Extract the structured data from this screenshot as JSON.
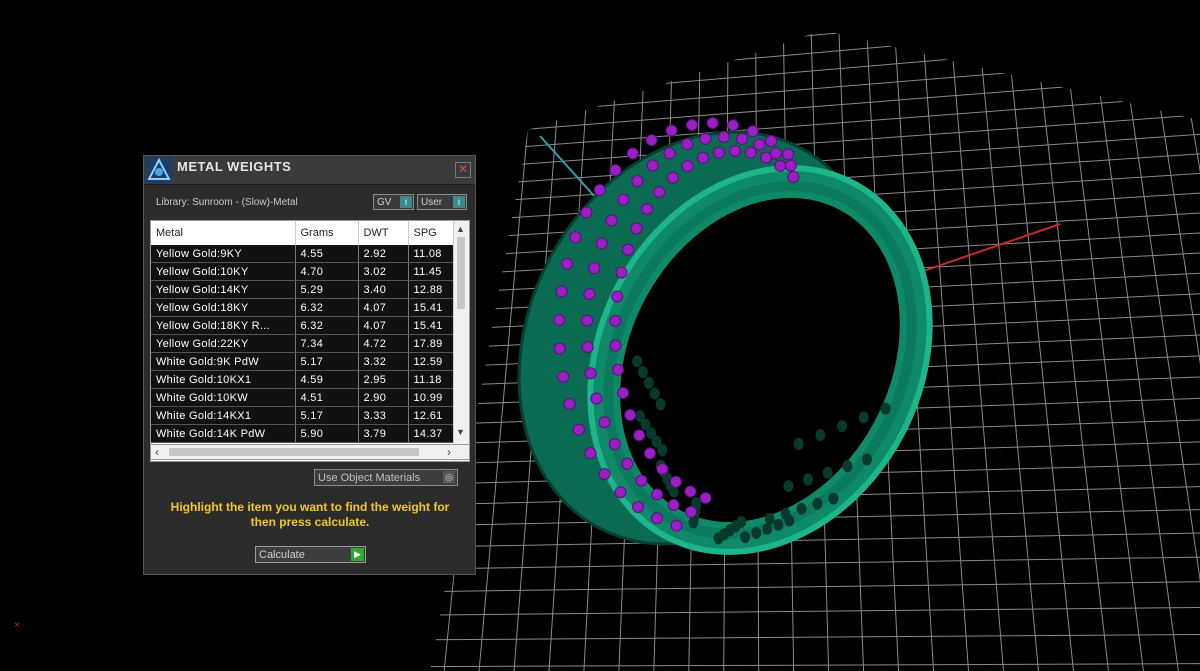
{
  "panel": {
    "title": "METAL WEIGHTS",
    "close_glyph": "✕",
    "library_label": "Library: Sunroom - (Slow)-Metal",
    "toggles": [
      {
        "label": "GV",
        "icon": "info-icon"
      },
      {
        "label": "User",
        "icon": "info-icon"
      }
    ],
    "columns": [
      "Metal",
      "Grams",
      "DWT",
      "SPG"
    ],
    "rows": [
      [
        "Yellow Gold:9KY",
        "4.55",
        "2.92",
        "11.08"
      ],
      [
        "Yellow Gold:10KY",
        "4.70",
        "3.02",
        "11.45"
      ],
      [
        "Yellow Gold:14KY",
        "5.29",
        "3.40",
        "12.88"
      ],
      [
        "Yellow Gold:18KY",
        "6.32",
        "4.07",
        "15.41"
      ],
      [
        "Yellow Gold:18KY R...",
        "6.32",
        "4.07",
        "15.41"
      ],
      [
        "Yellow Gold:22KY",
        "7.34",
        "4.72",
        "17.89"
      ],
      [
        "White Gold:9K PdW",
        "5.17",
        "3.32",
        "12.59"
      ],
      [
        "White Gold:10KX1",
        "4.59",
        "2.95",
        "11.18"
      ],
      [
        "White Gold:10KW",
        "4.51",
        "2.90",
        "10.99"
      ],
      [
        "White Gold:14KX1",
        "5.17",
        "3.33",
        "12.61"
      ],
      [
        "White Gold:14K PdW",
        "5.90",
        "3.79",
        "14.37"
      ]
    ],
    "use_object_materials_label": "Use Object Materials",
    "instruction": "Highlight the item you want to find the weight for then press calculate.",
    "calculate_label": "Calculate"
  },
  "colors": {
    "ring_body": "#0b7a5e",
    "ring_highlight": "#1fb58c",
    "gem": "#9a1fc4",
    "grid": "#8a8a8a",
    "axis_x": "#c42a2a",
    "axis_z": "#2aa0b5",
    "instruction_text": "#f3c728"
  }
}
